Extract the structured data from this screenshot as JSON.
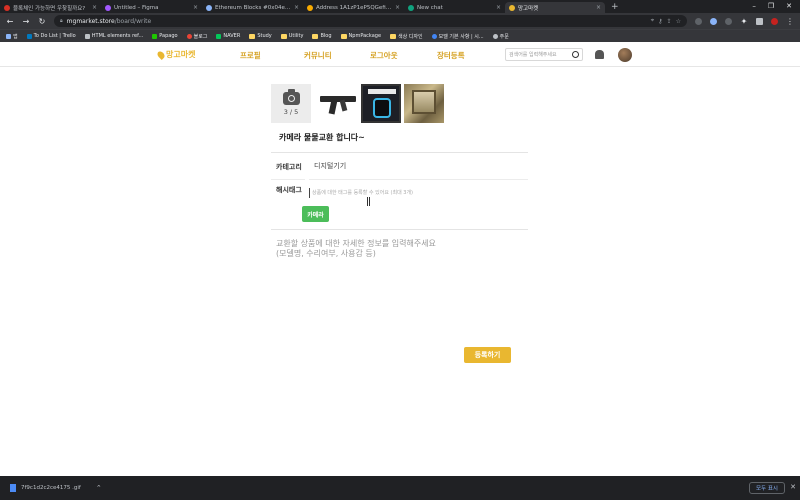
{
  "browser": {
    "tabs": [
      {
        "title": "블록체인 가능하면 우찾힐까요?",
        "color": "#d93025"
      },
      {
        "title": "Untitled – Figma",
        "color": "#a259ff"
      },
      {
        "title": "Ethereum Blocks #0x04e067405",
        "color": "#8ab4f8"
      },
      {
        "title": "Address 1A1zP1eP5QGefi2DMP",
        "color": "#f9ab00"
      },
      {
        "title": "New chat",
        "color": "#10a37f"
      },
      {
        "title": "망고마켓",
        "color": "#e9b730"
      }
    ],
    "new_tab": "+",
    "url_host": "mgmarket.store",
    "url_path": "/board/write",
    "bookmarks": [
      {
        "label": "앱",
        "color": "#8ab4f8"
      },
      {
        "label": "To Do List | Trello",
        "color": "#0079bf"
      },
      {
        "label": "HTML elements ref...",
        "color": "#bdc1c6"
      },
      {
        "label": "Papago",
        "color": "#1ec800"
      },
      {
        "label": "블로그",
        "color": "#ea4335"
      },
      {
        "label": "NAVER",
        "color": "#03c75a"
      },
      {
        "label": "Study",
        "color": "folder"
      },
      {
        "label": "Utility",
        "color": "folder"
      },
      {
        "label": "Blog",
        "color": "folder"
      },
      {
        "label": "NpmPackage",
        "color": "folder"
      },
      {
        "label": "색상 디자인",
        "color": "folder"
      },
      {
        "label": "모델 기본 사항 | 시...",
        "color": "#4285f4"
      },
      {
        "label": "주문",
        "color": "#bdc1c6"
      }
    ]
  },
  "site": {
    "logo": "망고마켓",
    "menu": [
      "프로필",
      "커뮤니티",
      "로그아웃",
      "장터등록"
    ],
    "search_placeholder": "검색어를 입력해주세요"
  },
  "form": {
    "image_count": "3 / 5",
    "title": "카메라 물물교환 합니다~",
    "category_label": "카테고리",
    "category_value": "디지털기기",
    "hashtag_label": "해시태그",
    "hashtag_placeholder": "상품에 대한 태그를 등록할 수 있어요 (최대 3개)",
    "tags": [
      "카메라"
    ],
    "description_placeholder": "교환할 상품에 대한 자세한 정보를 입력해주세요\n(모델명, 수리여부, 사용감 등)",
    "submit_label": "등록하기"
  },
  "downloads": {
    "file": "7f9c1d2c2ce4175 .gif",
    "show_all": "모두 표시"
  }
}
